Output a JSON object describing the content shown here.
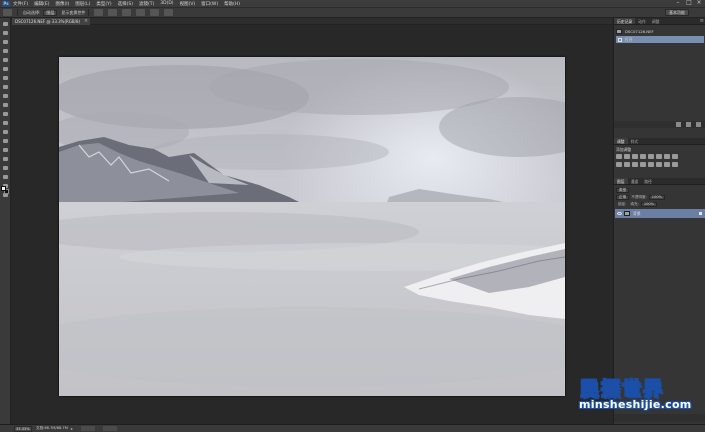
{
  "app": {
    "logo_text": "Ps",
    "menus": [
      "文件(F)",
      "编辑(E)",
      "图像(I)",
      "图层(L)",
      "类型(Y)",
      "选择(S)",
      "滤镜(T)",
      "3D(D)",
      "视图(V)",
      "窗口(W)",
      "帮助(H)"
    ],
    "window_controls": [
      "–",
      "□",
      "×"
    ]
  },
  "options_bar": {
    "tool_icon": "move-tool-icon",
    "auto_select_label": "自动选择:",
    "auto_select_value": "图层",
    "transform_label": "显示变换控件",
    "right_button": "基本功能"
  },
  "document": {
    "tab_title": "DSC07126.NEF @ 33.3%(RGB/8)",
    "close_glyph": "×"
  },
  "history_panel": {
    "tabs": [
      "历史记录",
      "动作",
      "调整"
    ],
    "snapshot_label": "DSC07126.NEF",
    "state_label": "打开",
    "menu_glyph": "≡"
  },
  "adjustments_panel": {
    "tabs": [
      "调整",
      "样式"
    ],
    "title": "添加调整",
    "icon_count": 20,
    "icons": [
      "brightness-contrast-icon",
      "levels-icon",
      "curves-icon",
      "exposure-icon",
      "vibrance-icon",
      "hue-saturation-icon",
      "color-balance-icon",
      "black-white-icon",
      "photo-filter-icon",
      "channel-mixer-icon",
      "color-lookup-icon",
      "invert-icon",
      "posterize-icon",
      "threshold-icon",
      "gradient-map-icon",
      "selective-color-icon"
    ]
  },
  "layers_panel": {
    "tabs": [
      "图层",
      "通道",
      "路径"
    ],
    "filter_label": "类型",
    "blend_mode": "正常",
    "opacity_label": "不透明度:",
    "opacity_value": "100%",
    "lock_label": "锁定:",
    "fill_label": "填充:",
    "fill_value": "100%",
    "layer_name": "背景"
  },
  "status_bar": {
    "zoom": "33.33%",
    "doc_info": "文档:68.7M/68.7M",
    "arrow_glyph": "▸"
  },
  "colors": {
    "foreground": "#f2f2f2",
    "background": "#111111",
    "selection": "#6b7fa3",
    "watermark_blue": "#1b4fa8"
  },
  "watermark": {
    "logo_text": "民摄世界",
    "url": "minsheshijie.com"
  }
}
